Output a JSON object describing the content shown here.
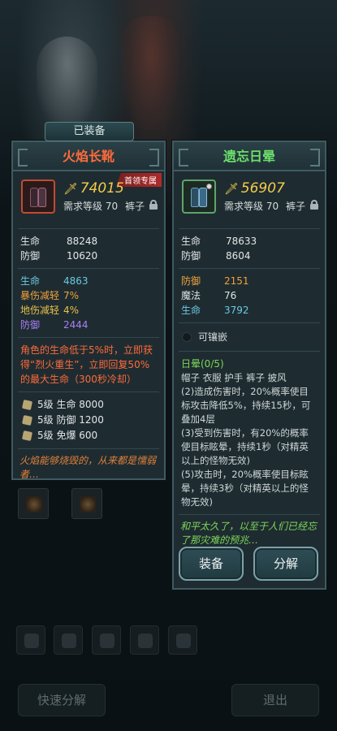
{
  "equipped_label": "已装备",
  "left": {
    "name": "火焰长靴",
    "badge": "首领专属",
    "power": "74015",
    "req": "需求等级 70",
    "slot": "裤子",
    "base_stats": [
      {
        "k": "生命",
        "v": "88248"
      },
      {
        "k": "防御",
        "v": "10620"
      }
    ],
    "extra_stats": [
      {
        "k": "生命",
        "v": "4863",
        "color": "#6cc8e0"
      },
      {
        "k": "暴伤减轻",
        "v": "7%",
        "color": "#f0a23c"
      },
      {
        "k": "地伤减轻",
        "v": "4%",
        "color": "#e8c04a"
      },
      {
        "k": "防御",
        "v": "2444",
        "color": "#a880f4"
      }
    ],
    "special": "角色的生命低于5%时，立即获得“烈火重生”，立即回复50%的最大生命（300秒冷却）",
    "tiers": [
      {
        "level": "5级",
        "text": "生命 8000"
      },
      {
        "level": "5级",
        "text": "防御 1200"
      },
      {
        "level": "5级",
        "text": "免爆 600"
      }
    ],
    "flavor": "火焰能够烧毁的，从来都是懦弱者…"
  },
  "right": {
    "name": "遗忘日晕",
    "power": "56907",
    "req": "需求等级 70",
    "slot": "裤子",
    "base_stats": [
      {
        "k": "生命",
        "v": "78633"
      },
      {
        "k": "防御",
        "v": "8604"
      }
    ],
    "extra_stats": [
      {
        "k": "防御",
        "v": "2151",
        "color": "#f0a23c"
      },
      {
        "k": "魔法",
        "v": "76",
        "color": "#dfe4e6"
      },
      {
        "k": "生命",
        "v": "3792",
        "color": "#6cc8e0"
      }
    ],
    "socket": "可镶嵌",
    "set_title": "日晕(0/5)",
    "set_pieces": "帽子 衣服 护手 裤子 披风",
    "set_bonus_1": "(2)造成伤害时，20%概率使目标攻击降低5%，持续15秒，可叠加4层",
    "set_bonus_2": "(3)受到伤害时，有20%的概率使目标眩晕，持续1秒（对精英以上的怪物无效)",
    "set_bonus_3": "(5)攻击时，20%概率使目标眩晕，持续3秒（对精英以上的怪物无效)",
    "flavor": "和平太久了，以至于人们已经忘了那灾难的预兆…",
    "equip_button": "装备",
    "dismantle_button": "分解"
  },
  "bottom": {
    "quick_dismantle": "快速分解",
    "exit": "退出"
  }
}
